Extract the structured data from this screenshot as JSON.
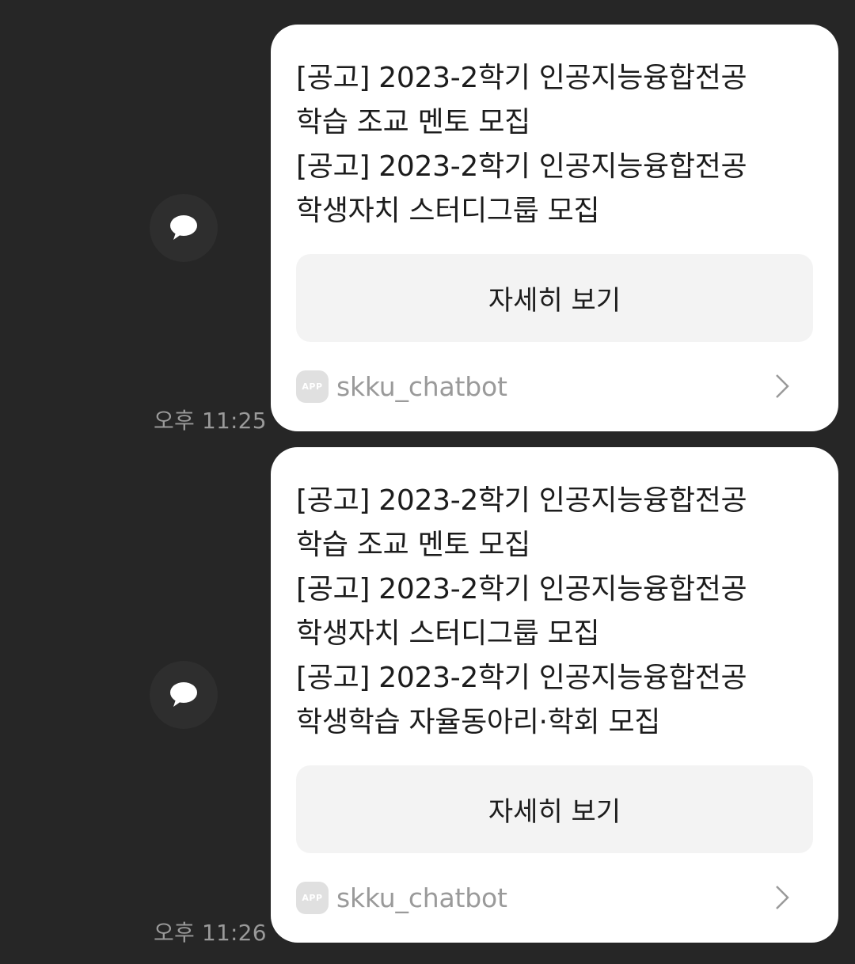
{
  "messages": [
    {
      "timestamp": "오후 11:25",
      "lines": [
        "[공고] 2023-2학기 인공지능융합전공",
        "학습 조교 멘토 모집",
        "[공고] 2023-2학기 인공지능융합전공",
        "학생자치 스터디그룹 모집"
      ],
      "button_label": "자세히 보기",
      "app_badge": "APP",
      "app_name": "skku_chatbot",
      "avatar_icon": "speech-bubble-icon",
      "footer_icon": "chevron-right-icon"
    },
    {
      "timestamp": "오후 11:26",
      "lines": [
        "[공고] 2023-2학기 인공지능융합전공",
        "학습 조교 멘토 모집",
        "[공고] 2023-2학기 인공지능융합전공",
        "학생자치 스터디그룹 모집",
        "[공고] 2023-2학기 인공지능융합전공",
        "학생학습 자율동아리·학회 모집"
      ],
      "button_label": "자세히 보기",
      "app_badge": "APP",
      "app_name": "skku_chatbot",
      "avatar_icon": "speech-bubble-icon",
      "footer_icon": "chevron-right-icon"
    }
  ],
  "colors": {
    "background": "#262626",
    "card": "#ffffff",
    "button": "#f3f3f3",
    "muted_text": "#9a9a9a"
  }
}
